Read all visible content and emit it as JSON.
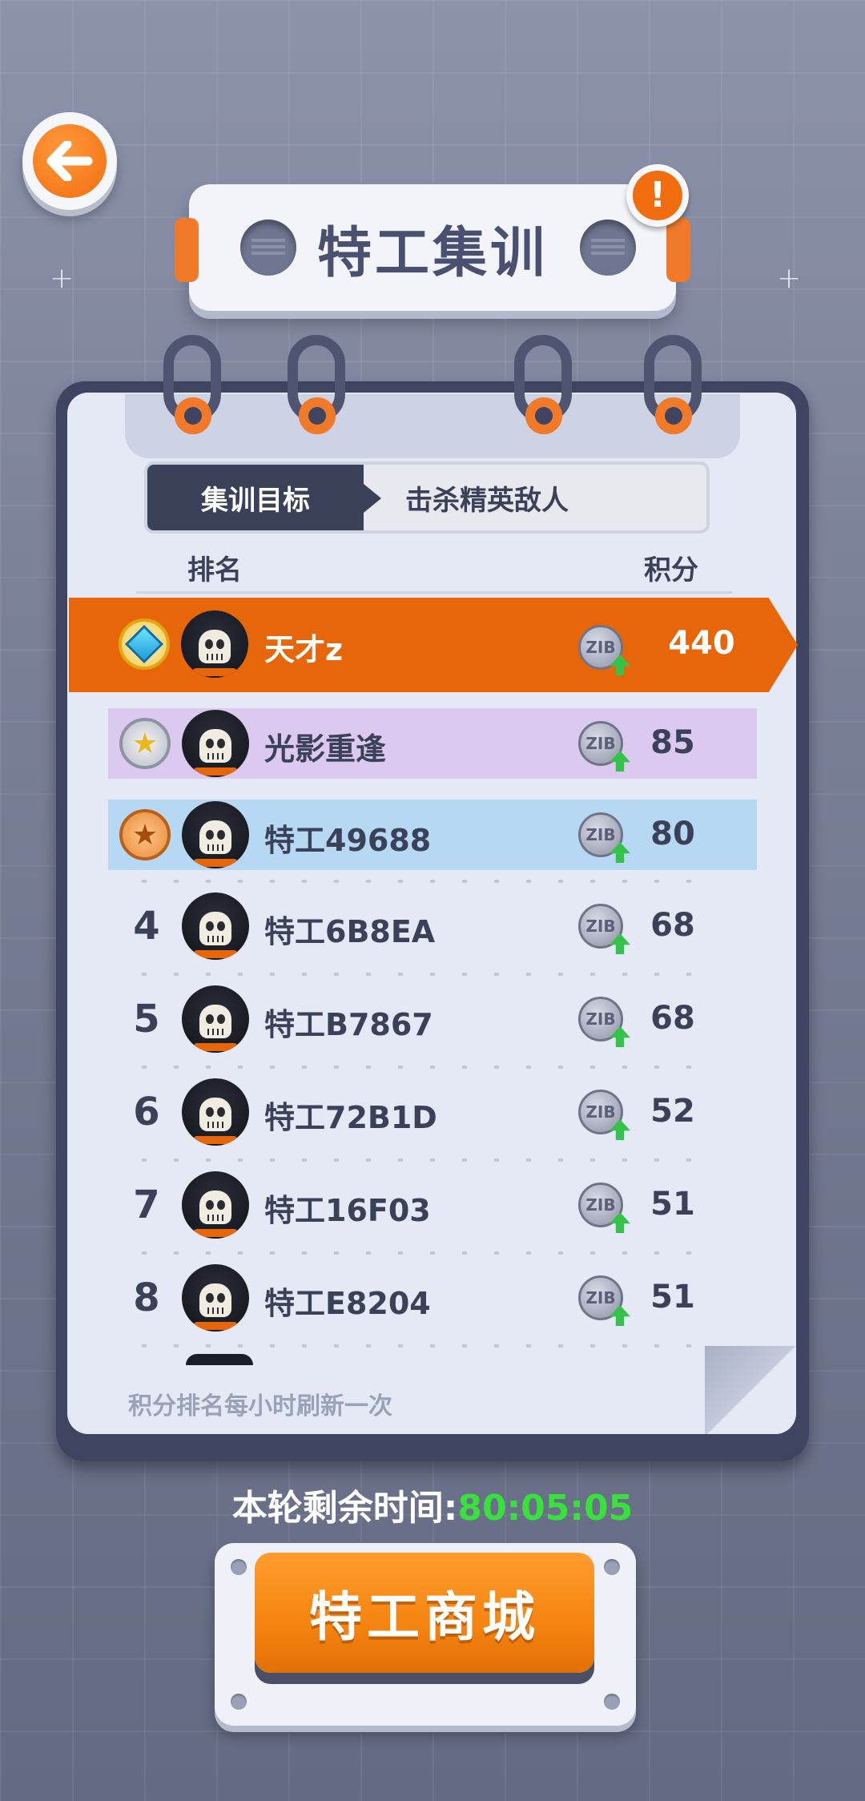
{
  "header": {
    "title": "特工集训",
    "info_symbol": "!"
  },
  "tabs": {
    "active": "集训目标",
    "inactive": "击杀精英敌人"
  },
  "columns": {
    "rank": "排名",
    "score": "积分"
  },
  "leaderboard": [
    {
      "rank": "1",
      "medal": "diamond",
      "name": "天才z",
      "score": "440",
      "coin_label": "ZIB"
    },
    {
      "rank": "2",
      "medal": "silver",
      "name": "光影重逢",
      "score": "85",
      "coin_label": "ZIB"
    },
    {
      "rank": "3",
      "medal": "bronze",
      "name": "特工49688",
      "score": "80",
      "coin_label": "ZIB"
    },
    {
      "rank": "4",
      "medal": null,
      "name": "特工6B8EA",
      "score": "68",
      "coin_label": "ZIB"
    },
    {
      "rank": "5",
      "medal": null,
      "name": "特工B7867",
      "score": "68",
      "coin_label": "ZIB"
    },
    {
      "rank": "6",
      "medal": null,
      "name": "特工72B1D",
      "score": "52",
      "coin_label": "ZIB"
    },
    {
      "rank": "7",
      "medal": null,
      "name": "特工16F03",
      "score": "51",
      "coin_label": "ZIB"
    },
    {
      "rank": "8",
      "medal": null,
      "name": "特工E8204",
      "score": "51",
      "coin_label": "ZIB"
    }
  ],
  "footer_note": "积分排名每小时刷新一次",
  "timer": {
    "label": "本轮剩余时间:",
    "value": "80:05:05"
  },
  "shop_button": "特工商城",
  "colors": {
    "accent_orange": "#e8660a",
    "timer_green": "#37e23b",
    "rank2_bg": "#dcc9ef",
    "rank3_bg": "#b6d8f3"
  }
}
